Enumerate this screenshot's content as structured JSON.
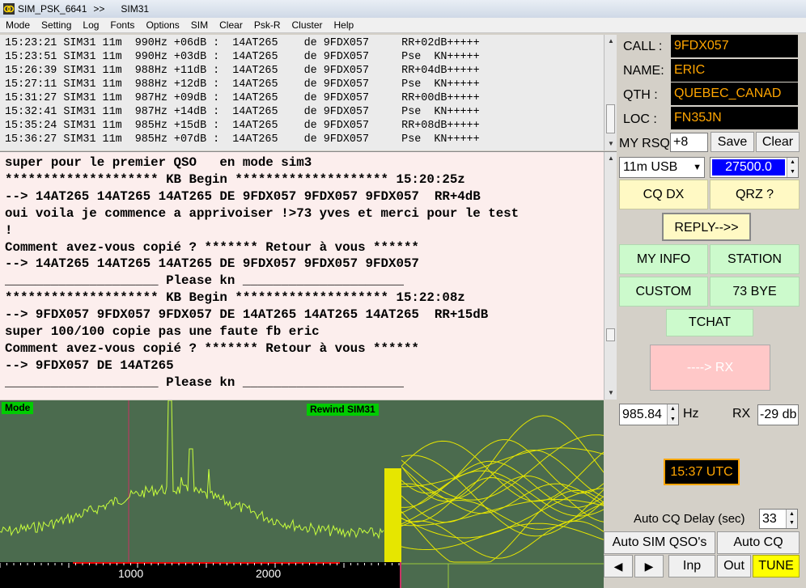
{
  "window": {
    "title_parts": [
      "SIM_PSK_6641",
      ">>",
      "SIM31"
    ]
  },
  "menu": [
    "Mode",
    "Setting",
    "Log",
    "Fonts",
    "Options",
    "SIM",
    "Clear",
    "Psk-R",
    "Cluster",
    "Help"
  ],
  "log_rows": [
    "15:23:21 SIM31 11m  990Hz +06dB :  14AT265    de 9FDX057     RR+02dB+++++",
    "15:23:51 SIM31 11m  990Hz +03dB :  14AT265    de 9FDX057     Pse  KN+++++",
    "15:26:39 SIM31 11m  988Hz +11dB :  14AT265    de 9FDX057     RR+04dB+++++",
    "15:27:11 SIM31 11m  988Hz +12dB :  14AT265    de 9FDX057     Pse  KN+++++",
    "15:31:27 SIM31 11m  987Hz +09dB :  14AT265    de 9FDX057     RR+00dB+++++",
    "15:32:41 SIM31 11m  987Hz +14dB :  14AT265    de 9FDX057     Pse  KN+++++",
    "15:35:24 SIM31 11m  985Hz +15dB :  14AT265    de 9FDX057     RR+08dB+++++",
    "15:36:27 SIM31 11m  985Hz +07dB :  14AT265    de 9FDX057     Pse  KN+++++"
  ],
  "chat_lines": [
    "super pour le premier QSO   en mode sim3",
    "******************** KB Begin ******************** 15:20:25z",
    "--> 14AT265 14AT265 14AT265 DE 9FDX057 9FDX057 9FDX057  RR+4dB",
    "oui voila je commence a apprivoiser !>73 yves et merci pour le test",
    "!",
    "Comment avez-vous copié ? ******* Retour à vous ******",
    "--> 14AT265 14AT265 14AT265 DE 9FDX057 9FDX057 9FDX057",
    "____________________ Please kn _____________________",
    "******************** KB Begin ******************** 15:22:08z",
    "--> 9FDX057 9FDX057 9FDX057 DE 14AT265 14AT265 14AT265  RR+15dB",
    "super 100/100 copie pas une faute fb eric",
    "Comment avez-vous copié ? ******* Retour à vous ******",
    "--> 9FDX057 DE 14AT265",
    "____________________ Please kn _____________________"
  ],
  "waterfall": {
    "mode_tag": "Mode",
    "rewind_tag": "Rewind SIM31",
    "scale_labels": [
      "1000",
      "2000"
    ]
  },
  "station": {
    "call_label": "CALL :",
    "call_value": "9FDX057",
    "name_label": "NAME:",
    "name_value": "ERIC",
    "qth_label": "QTH  :",
    "qth_value": "QUEBEC_CANAD",
    "loc_label": "LOC  :",
    "loc_value": "FN35JN",
    "rsq_label": "MY RSQ",
    "rsq_value": "+8",
    "save_label": "Save",
    "clear_label": "Clear",
    "band_value": "11m  USB",
    "freq_value": "27500.0"
  },
  "buttons": {
    "cq_dx": "CQ DX",
    "qrz": "QRZ ?",
    "reply": "REPLY-->>",
    "my_info": "MY INFO",
    "station": "STATION",
    "custom": "CUSTOM",
    "bye": "73 BYE",
    "tchat": "TCHAT",
    "rx": "----> RX",
    "auto_sim": "Auto SIM QSO's",
    "auto_cq": "Auto CQ",
    "inp": "Inp",
    "out": "Out",
    "tune": "TUNE",
    "prev": "◀",
    "next": "▶"
  },
  "tuning": {
    "hz_value": "985.84",
    "hz_unit": "Hz",
    "rx_label": "RX",
    "rx_db": "-29 db",
    "utc_time": "15:37 UTC",
    "auto_cq_delay_label": "Auto CQ Delay (sec)",
    "auto_cq_delay_value": "33"
  },
  "colors": {
    "field_bg": "#000000",
    "field_text": "#ffa500",
    "freq_bg": "#0000ff",
    "button_yellow": "#fff9c4",
    "button_green": "#ccfacc",
    "rx_button": "#ffc8c8",
    "tune_bg": "#ffff00",
    "chat_bg": "#fceeed",
    "spectrum_bg": "#4b6b4e",
    "spectrum_trace": "#c8ff3c",
    "scope_trace": "#e6e600"
  }
}
